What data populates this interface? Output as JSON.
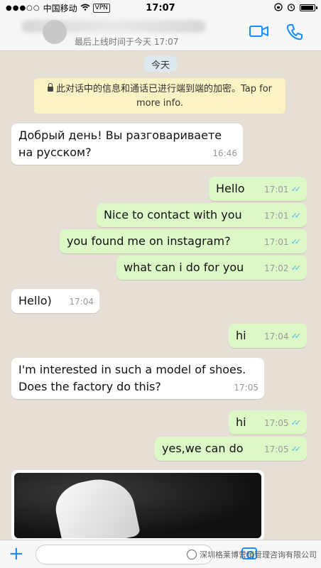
{
  "status_bar": {
    "signal": "●●●○○",
    "carrier": "中国移动",
    "vpn": "VPN",
    "time": "17:07"
  },
  "header": {
    "last_seen": "最后上线时间于今天 17:07",
    "video_icon": "video-call-icon",
    "call_icon": "phone-icon",
    "accent_color": "#1a8cff"
  },
  "chat": {
    "day_label": "今天",
    "encryption_notice": "此对话中的信息和通话已进行端到端的加密。Tap for more info.",
    "messages": [
      {
        "dir": "in",
        "text": "Добрый день! Вы разговариваете на русском?",
        "time": "16:46"
      },
      {
        "dir": "out",
        "text": "Hello",
        "time": "17:01"
      },
      {
        "dir": "out",
        "text": "Nice to contact with you",
        "time": "17:01"
      },
      {
        "dir": "out",
        "text": "you found me on instagram?",
        "time": "17:01"
      },
      {
        "dir": "out",
        "text": "what can i do for you",
        "time": "17:02"
      },
      {
        "dir": "in",
        "text": "Hello)",
        "time": "17:04"
      },
      {
        "dir": "out",
        "text": "hi",
        "time": "17:04"
      },
      {
        "dir": "in",
        "text": "I'm interested in such a model of shoes. Does the factory do this?",
        "time": "17:05"
      },
      {
        "dir": "out",
        "text": "hi",
        "time": "17:05"
      },
      {
        "dir": "out",
        "text": "yes,we can do",
        "time": "17:05"
      }
    ],
    "read_ticks": "✓✓"
  },
  "bottom_bar": {
    "plus": "+",
    "watermark": "深圳格莱博营销管理咨询有限公司"
  },
  "colors": {
    "chat_background": "#e6dfd5",
    "outgoing_bubble": "#dcf8c6",
    "incoming_bubble": "#ffffff",
    "tick_color": "#4fb6ec"
  }
}
